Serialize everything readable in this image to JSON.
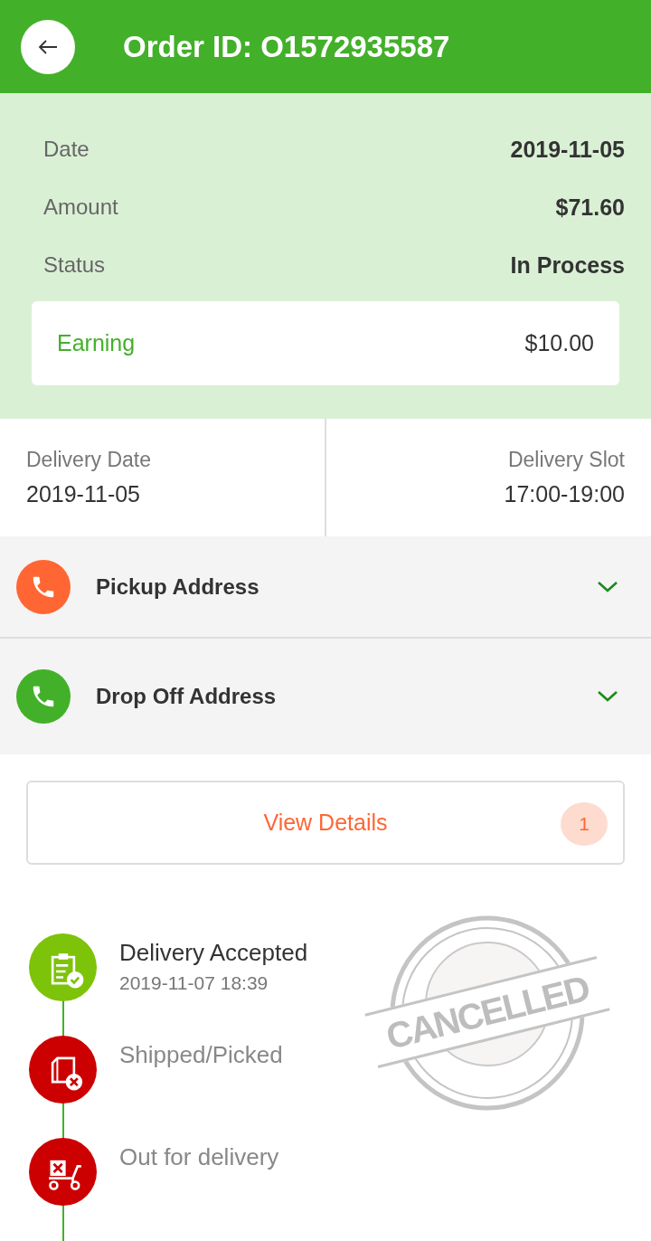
{
  "header": {
    "title": "Order ID: O1572935587"
  },
  "summary": [
    {
      "label": "Date",
      "value": "2019-11-05"
    },
    {
      "label": "Amount",
      "value": "$71.60"
    },
    {
      "label": "Status",
      "value": "In Process"
    }
  ],
  "earning": {
    "label": "Earning",
    "value": "$10.00"
  },
  "delivery": [
    {
      "label": "Delivery Date",
      "value": "2019-11-05"
    },
    {
      "label": "Delivery Slot",
      "value": "17:00-19:00"
    }
  ],
  "addresses": [
    {
      "label": "Pickup Address",
      "color": "#ff6633",
      "expanded": false
    },
    {
      "label": "Drop Off Address",
      "color": "#43b02a",
      "expanded": false
    }
  ],
  "view_details": {
    "label": "View Details",
    "badge": "1"
  },
  "timeline": [
    {
      "kind": "accepted",
      "done": true,
      "title": "Delivery Accepted",
      "time": "2019-11-07 18:39"
    },
    {
      "kind": "picked",
      "done": false,
      "title": "Shipped/Picked"
    },
    {
      "kind": "delivery",
      "done": false,
      "title": "Out for delivery"
    }
  ],
  "stamp": {
    "text": "CANCELLED"
  }
}
